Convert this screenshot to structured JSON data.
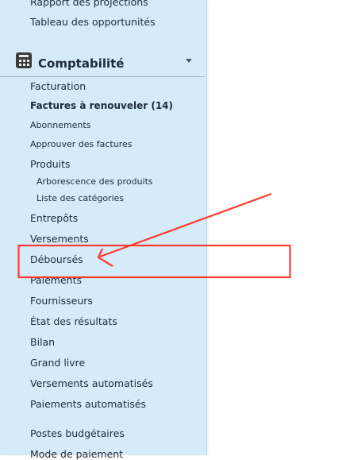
{
  "sidebar": {
    "top_items": [
      "Rapport des projections",
      "Tableau des opportunités"
    ],
    "section": {
      "title": "Comptabilité",
      "icon": "calculator-icon"
    },
    "items": [
      "Facturation",
      "Factures à renouveler (14)",
      "Abonnements",
      "Approuver des factures",
      "Produits",
      "Arborescence des produits",
      "Liste des catégories",
      "Entrepôts",
      "Versements",
      "Déboursés",
      "Paiements",
      "Fournisseurs",
      "État des résultats",
      "Bilan",
      "Grand livre",
      "Versements automatisés",
      "Paiements automatisés",
      "Postes budgétaires",
      "Mode de paiement"
    ]
  },
  "annotation": {
    "color": "#ff3b2f",
    "target": "Déboursés"
  }
}
